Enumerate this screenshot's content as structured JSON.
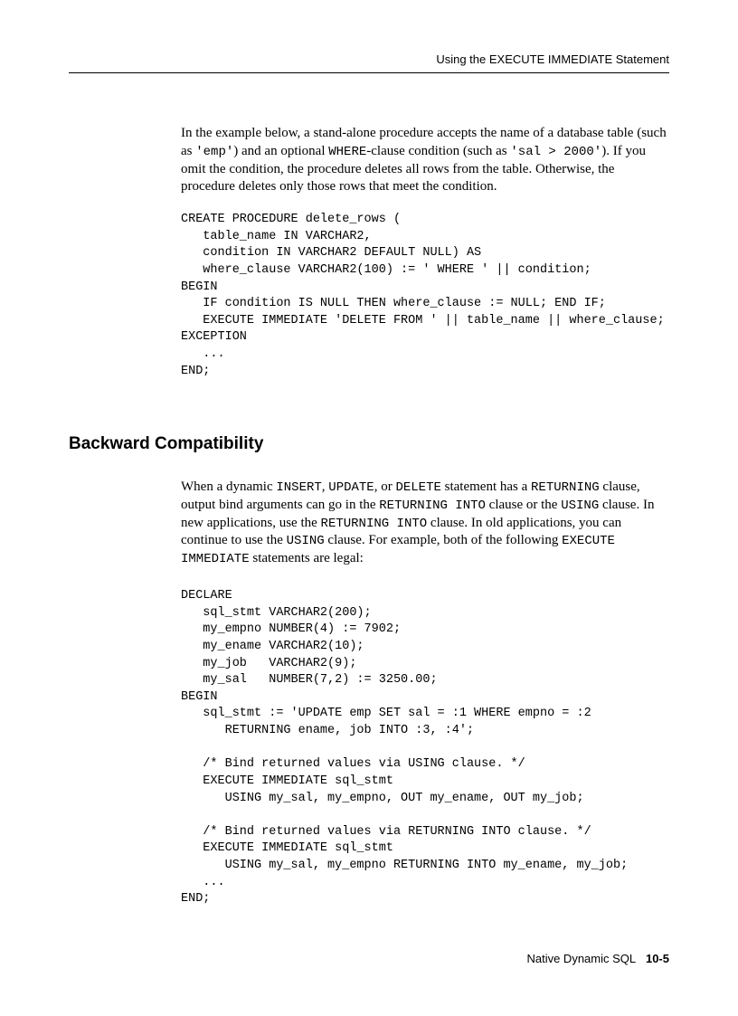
{
  "header": {
    "running_head": "Using the EXECUTE IMMEDIATE Statement"
  },
  "para1": {
    "t1": "In the example below, a stand-alone procedure accepts the name of a database table (such as ",
    "c1": "'emp'",
    "t2": ") and an optional ",
    "c2": "WHERE",
    "t3": "-clause condition (such as ",
    "c3": "'sal > 2000'",
    "t4": "). If you omit the condition, the procedure deletes all rows from the table. Otherwise, the procedure deletes only those rows that meet the condition."
  },
  "code1": "CREATE PROCEDURE delete_rows (\n   table_name IN VARCHAR2,\n   condition IN VARCHAR2 DEFAULT NULL) AS\n   where_clause VARCHAR2(100) := ' WHERE ' || condition;\nBEGIN\n   IF condition IS NULL THEN where_clause := NULL; END IF;\n   EXECUTE IMMEDIATE 'DELETE FROM ' || table_name || where_clause;\nEXCEPTION\n   ...\nEND;",
  "heading": "Backward Compatibility",
  "para2": {
    "t1": "When a dynamic ",
    "c1": "INSERT",
    "t2": ", ",
    "c2": "UPDATE",
    "t3": ", or ",
    "c3": "DELETE",
    "t4": " statement has a ",
    "c4": "RETURNING",
    "t5": " clause, output bind arguments can go in the ",
    "c5": "RETURNING INTO",
    "t6": " clause or the ",
    "c6": "USING",
    "t7": " clause. In new applications, use the ",
    "c7": "RETURNING INTO",
    "t8": " clause. In old applications, you can continue to use the ",
    "c8": "USING",
    "t9": " clause. For example, both of the following ",
    "c9": "EXECUTE IMMEDIATE",
    "t10": " statements are legal:"
  },
  "code2": "DECLARE\n   sql_stmt VARCHAR2(200);\n   my_empno NUMBER(4) := 7902;\n   my_ename VARCHAR2(10);\n   my_job   VARCHAR2(9);\n   my_sal   NUMBER(7,2) := 3250.00;\nBEGIN\n   sql_stmt := 'UPDATE emp SET sal = :1 WHERE empno = :2\n      RETURNING ename, job INTO :3, :4';\n\n   /* Bind returned values via USING clause. */\n   EXECUTE IMMEDIATE sql_stmt\n      USING my_sal, my_empno, OUT my_ename, OUT my_job;\n\n   /* Bind returned values via RETURNING INTO clause. */\n   EXECUTE IMMEDIATE sql_stmt\n      USING my_sal, my_empno RETURNING INTO my_ename, my_job;\n   ...\nEND;",
  "footer": {
    "section": "Native Dynamic SQL",
    "page": "10-5"
  }
}
